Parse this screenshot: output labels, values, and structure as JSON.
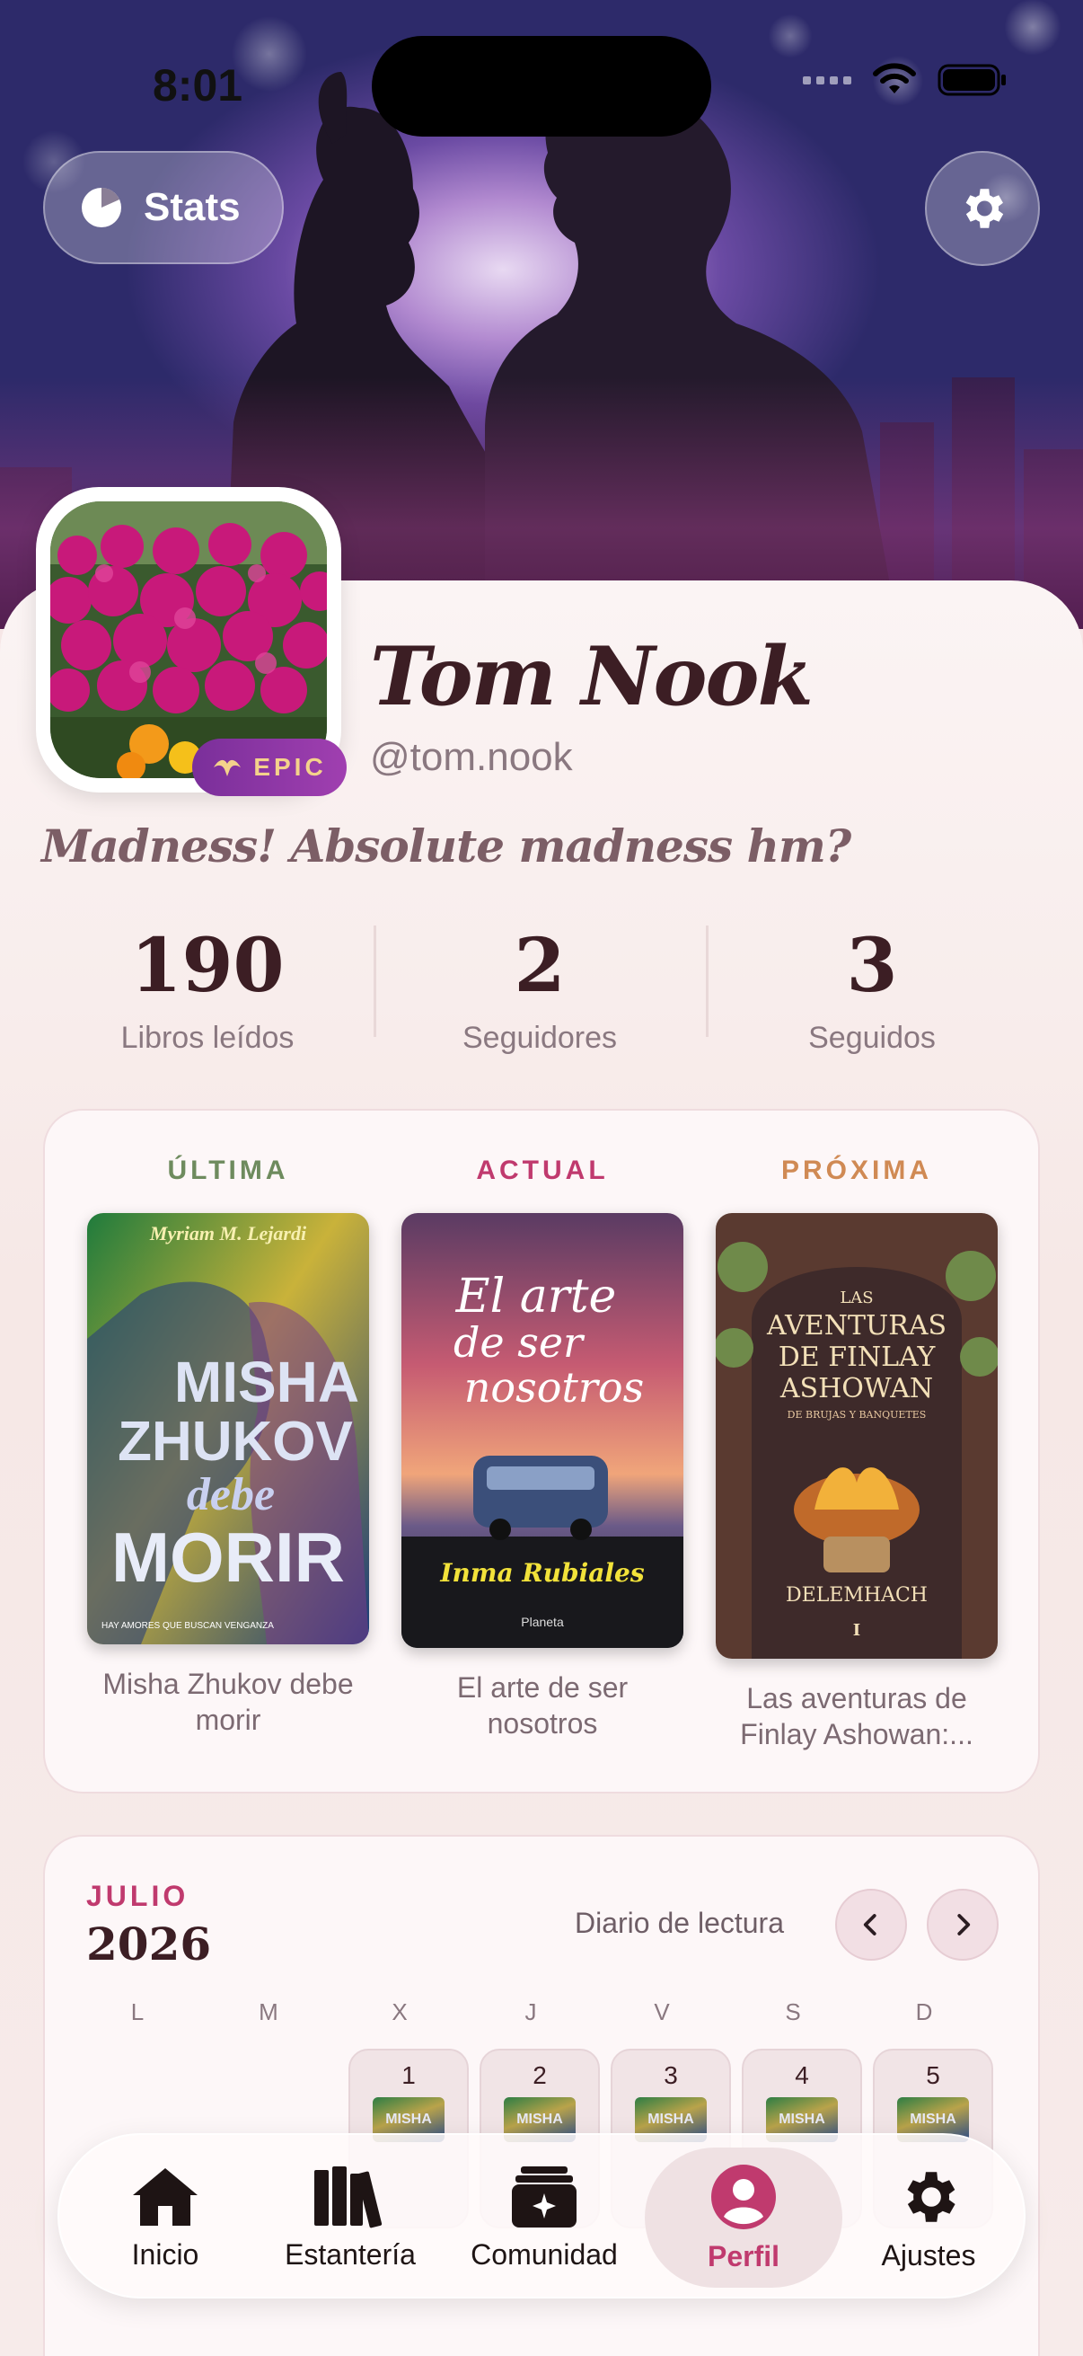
{
  "status": {
    "time": "8:01"
  },
  "header": {
    "stats_label": "Stats"
  },
  "profile": {
    "name": "Tom Nook",
    "handle": "@tom.nook",
    "badge": "EPIC",
    "bio": "Madness! Absolute madness hm?"
  },
  "stats": [
    {
      "value": "190",
      "label": "Libros leídos"
    },
    {
      "value": "2",
      "label": "Seguidores"
    },
    {
      "value": "3",
      "label": "Seguidos"
    }
  ],
  "books": [
    {
      "tag": "ÚLTIMA",
      "color": "#6e8b5e",
      "title": "Misha Zhukov debe morir",
      "cover": {
        "author": "Myriam M. Lejardi",
        "lines": [
          "MISHA",
          "ZHUKOV",
          "debe",
          "MORIR"
        ],
        "foot": "HAY AMORES QUE BUSCAN VENGANZA"
      }
    },
    {
      "tag": "ACTUAL",
      "color": "#c03a6e",
      "title": "El arte de ser nosotros",
      "cover": {
        "lines": [
          "El arte",
          "de ser",
          "nosotros"
        ],
        "author": "Inma Rubiales",
        "publisher": "Planeta"
      }
    },
    {
      "tag": "PRÓXIMA",
      "color": "#d08a54",
      "title": "Las aventuras de Finlay Ashowan:...",
      "cover": {
        "lines": [
          "LAS",
          "AVENTURAS",
          "DE FINLAY",
          "ASHOWAN"
        ],
        "subtitle": "DE BRUJAS Y BANQUETES",
        "author": "DELEMHACH",
        "number": "I"
      }
    }
  ],
  "calendar": {
    "month": "JULIO",
    "year": "2026",
    "diary_label": "Diario de lectura",
    "weekdays": [
      "L",
      "M",
      "X",
      "J",
      "V",
      "S",
      "D"
    ],
    "days": [
      "1",
      "2",
      "3",
      "4",
      "5"
    ],
    "thumb": "MISHA"
  },
  "tabs": [
    {
      "label": "Inicio",
      "icon": "house-icon"
    },
    {
      "label": "Estantería",
      "icon": "books-icon"
    },
    {
      "label": "Comunidad",
      "icon": "community-cards-icon"
    },
    {
      "label": "Perfil",
      "icon": "person-circle-icon",
      "active": true
    },
    {
      "label": "Ajustes",
      "icon": "gear-icon"
    }
  ],
  "colors": {
    "accent": "#c03a6e",
    "ink": "#3c1e24",
    "muted": "#8a7880"
  }
}
